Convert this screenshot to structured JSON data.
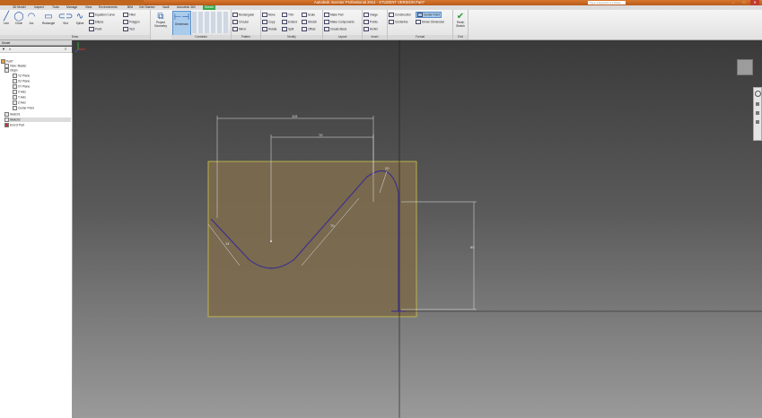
{
  "window": {
    "title": "Autodesk Inventor Professional 2014 - STUDENT VERSION   Part7",
    "search_placeholder": "Type a keyword or phrase"
  },
  "ribbon_tabs": [
    {
      "label": "3D Model"
    },
    {
      "label": "Inspect"
    },
    {
      "label": "Tools"
    },
    {
      "label": "Manage"
    },
    {
      "label": "View"
    },
    {
      "label": "Environments"
    },
    {
      "label": "BIM"
    },
    {
      "label": "Get Started"
    },
    {
      "label": "Vault"
    },
    {
      "label": "Autodesk 360"
    },
    {
      "label": "Sketch"
    }
  ],
  "draw": {
    "label": "Draw",
    "line": "Line",
    "circle": "Circle",
    "arc": "Arc",
    "rectangle": "Rectangle",
    "slot": "Slot",
    "spline": "Spline",
    "equation_curve": "Equation Curve",
    "ellipse": "Ellipse",
    "point": "Point",
    "fillet": "Fillet",
    "polygon": "Polygon",
    "text": "Text",
    "project_geometry": "Project Geometry"
  },
  "constrain": {
    "label": "Constrain",
    "dimension": "Dimension"
  },
  "pattern": {
    "label": "Pattern",
    "rectangular": "Rectangular",
    "circular": "Circular",
    "mirror": "Mirror"
  },
  "modify": {
    "label": "Modify",
    "move": "Move",
    "copy": "Copy",
    "rotate": "Rotate",
    "trim": "Trim",
    "extend": "Extend",
    "split": "Split",
    "scale": "Scale",
    "stretch": "Stretch",
    "offset": "Offset"
  },
  "layout": {
    "label": "Layout",
    "make_part": "Make Part",
    "make_components": "Make Components",
    "create_block": "Create Block"
  },
  "insert": {
    "label": "Insert",
    "image": "Image",
    "points": "Points",
    "acad": "ACAD"
  },
  "format": {
    "label": "Format",
    "construction": "Construction",
    "centerline": "Centerline",
    "center_point": "Center Point",
    "driven_dimension": "Driven Dimension"
  },
  "exit": {
    "label": "Exit",
    "finish_sketch": "Finish Sketch"
  },
  "browser": {
    "tab": "Model",
    "items": [
      {
        "label": "Part7"
      },
      {
        "label": "View: Master"
      },
      {
        "label": "Origin"
      },
      {
        "label": "YZ Plane"
      },
      {
        "label": "XZ Plane"
      },
      {
        "label": "XY Plane"
      },
      {
        "label": "X Axis"
      },
      {
        "label": "Y Axis"
      },
      {
        "label": "Z Axis"
      },
      {
        "label": "Center Point"
      },
      {
        "label": "Sketch1"
      },
      {
        "label": "Sketch2"
      },
      {
        "label": "End of Part"
      }
    ]
  },
  "sketch": {
    "dim_overall_width": "119",
    "dim_inner_width": "70",
    "dim_radius": "20",
    "dim_left_edge": "14",
    "dim_slant": "70",
    "dim_height": "60"
  },
  "colors": {
    "sketch_fill": "#7b6a4e",
    "sketch_border": "#cfc54a",
    "profile": "#3b2d8f",
    "dimension": "#e6e6e6",
    "active_tab": "#35a84a"
  }
}
